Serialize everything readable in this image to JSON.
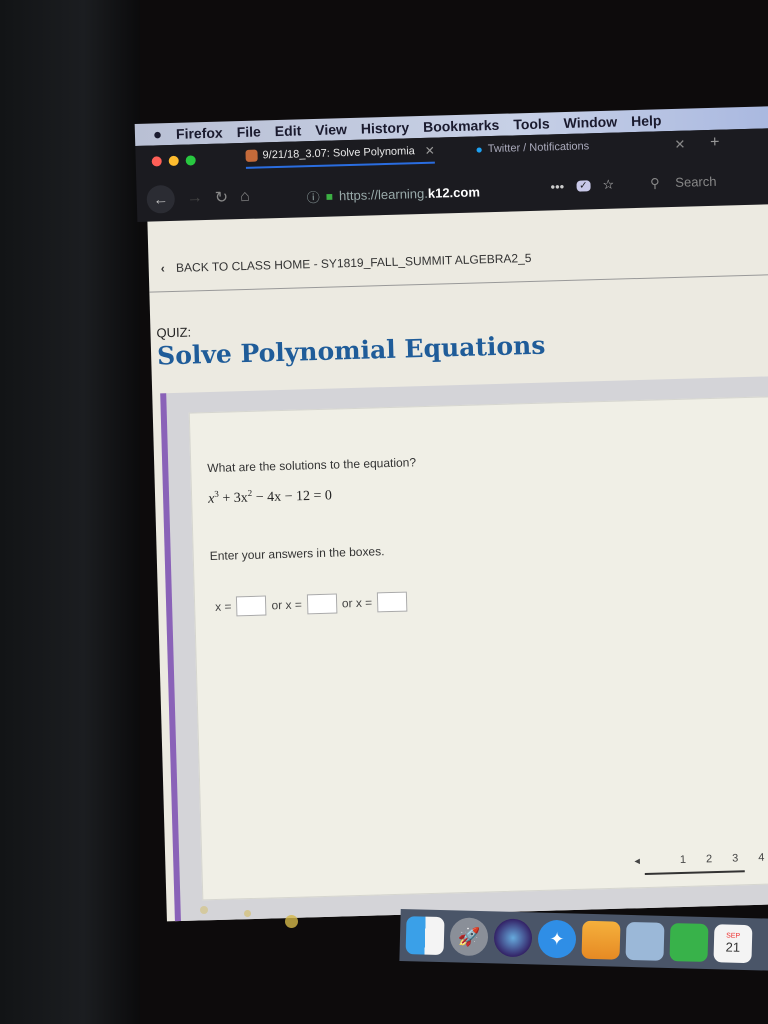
{
  "menubar": {
    "apple": "",
    "items": [
      "Firefox",
      "File",
      "Edit",
      "View",
      "History",
      "Bookmarks",
      "Tools",
      "Window",
      "Help"
    ]
  },
  "tabs": [
    {
      "label": "9/21/18_3.07: Solve Polynomia",
      "active": true,
      "close": "✕"
    },
    {
      "label": "Twitter / Notifications",
      "active": false
    }
  ],
  "tab_controls": {
    "close_all": "✕",
    "new_tab": "+"
  },
  "nav": {
    "back": "←",
    "forward": "→",
    "reload": "↻",
    "home": "⌂",
    "url_prefix": "https://learning.",
    "url_domain": "k12.com",
    "more": "•••",
    "pocket": "✓",
    "bookmark": "☆",
    "search_icon": "⚲",
    "search_label": "Search"
  },
  "page": {
    "back_link": "BACK TO CLASS HOME - SY1819_FALL_SUMMIT ALGEBRA2_5",
    "quiz_label": "QUIZ:",
    "quiz_title": "Solve Polynomial Equations",
    "question": "What are the solutions to the equation?",
    "equation": {
      "t1": "x",
      "t1exp": "3",
      "t2": " + 3x",
      "t2exp": "2",
      "rest": " − 4x − 12 = 0"
    },
    "instruction": "Enter your answers in the boxes.",
    "answer_prefix": "x =",
    "answer_or": "or x =",
    "answers": [
      "",
      "",
      ""
    ]
  },
  "pager": {
    "prev": "◂",
    "pages": [
      "1",
      "2",
      "3",
      "4"
    ]
  },
  "dock": {
    "items": [
      "Finder",
      "Launchpad",
      "Siri",
      "Safari",
      "Pages",
      "Preview",
      "FaceTime",
      "Calendar"
    ],
    "calendar_month": "SEP",
    "calendar_day": "21"
  }
}
